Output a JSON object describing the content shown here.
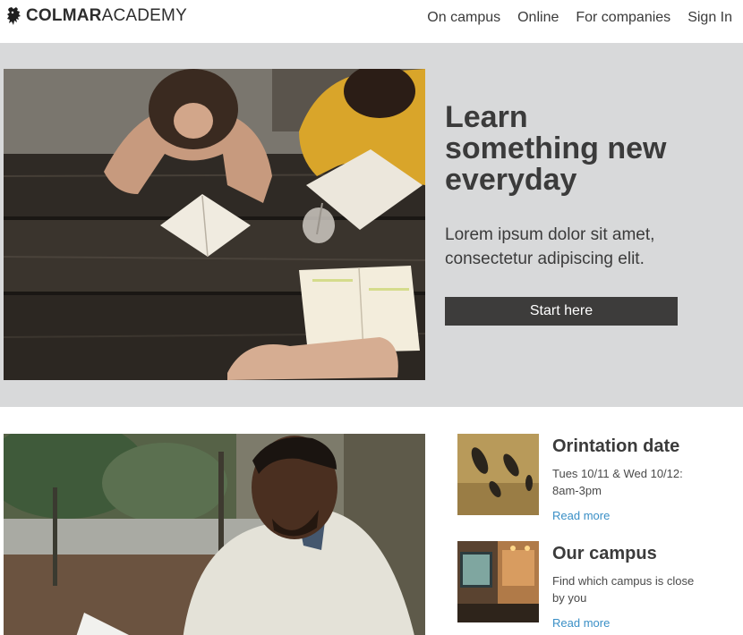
{
  "header": {
    "logo_bold": "COLMAR",
    "logo_light": "ACADEMY",
    "logo_icon": "lion-icon",
    "nav": [
      {
        "label": "On campus"
      },
      {
        "label": "Online"
      },
      {
        "label": "For companies"
      },
      {
        "label": "Sign In"
      }
    ]
  },
  "hero": {
    "title_lines": [
      "Learn",
      "something new",
      "everyday"
    ],
    "subtitle_lines": [
      "Lorem ipsum dolor sit amet,",
      "consectetur adipiscing elit."
    ],
    "cta_label": "Start here",
    "image": "students-studying-at-table-photo"
  },
  "features": {
    "image": "student-reading-outdoors-photo",
    "cards": [
      {
        "title": "Orintation date",
        "text_lines": [
          "Tues 10/11 & Wed 10/12:",
          "8am-3pm"
        ],
        "link": "Read more",
        "thumb": "birds-on-ground-photo"
      },
      {
        "title": "Our campus",
        "text_lines": [
          "Find which campus is close",
          "by you"
        ],
        "link": "Read more",
        "thumb": "campus-interior-photo"
      }
    ]
  },
  "colors": {
    "hero_bg": "#d8d9da",
    "cta_bg": "#3d3c3b",
    "link": "#3a8fc6",
    "text": "#3b3b3b"
  }
}
